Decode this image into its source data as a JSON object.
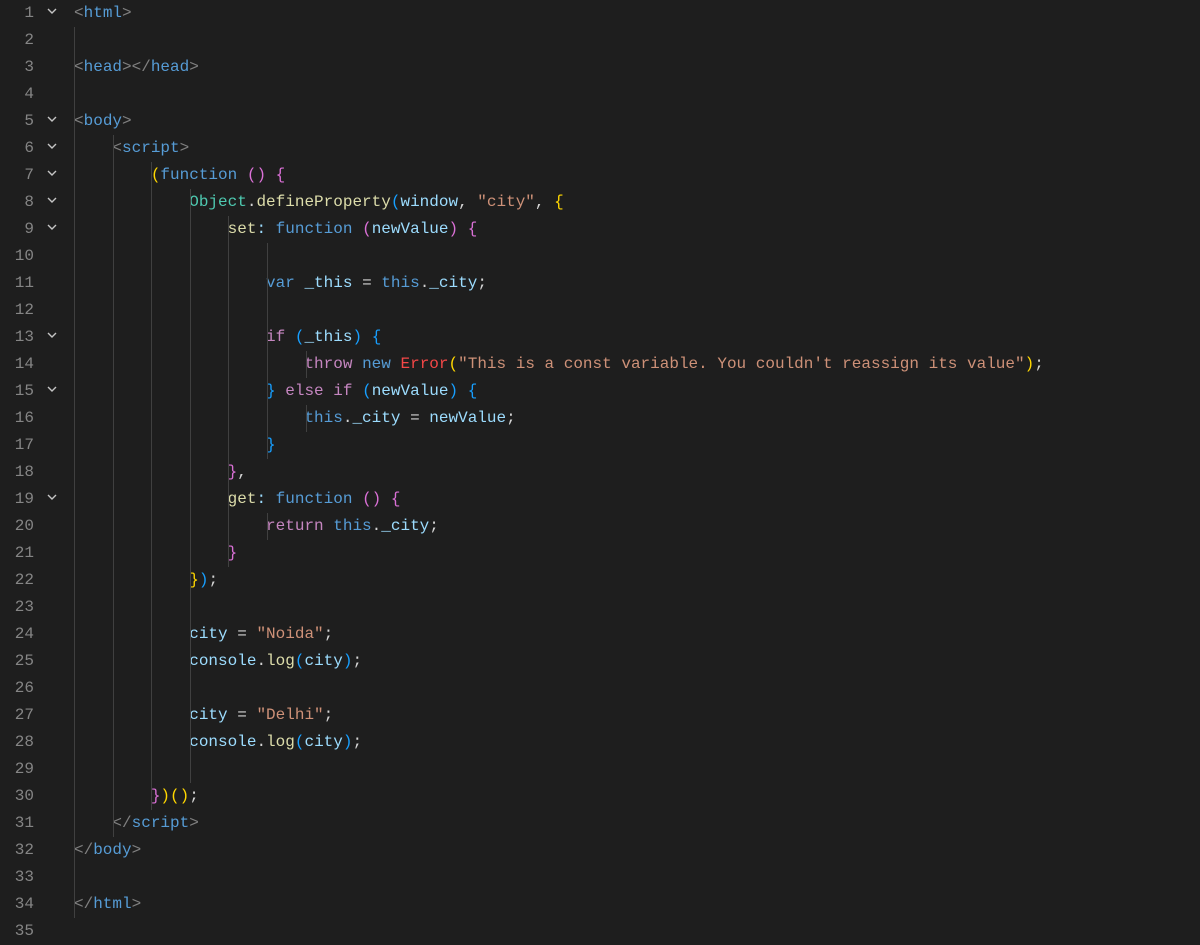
{
  "lines": [
    {
      "n": 1,
      "fold": "v",
      "guides": [],
      "tokens": [
        {
          "c": "punct",
          "t": "<"
        },
        {
          "c": "tag",
          "t": "html"
        },
        {
          "c": "punct",
          "t": ">"
        }
      ]
    },
    {
      "n": 2,
      "fold": "",
      "guides": [
        0
      ],
      "tokens": []
    },
    {
      "n": 3,
      "fold": "",
      "guides": [
        0
      ],
      "tokens": [
        {
          "c": "punct",
          "t": "<"
        },
        {
          "c": "tag",
          "t": "head"
        },
        {
          "c": "punct",
          "t": "></"
        },
        {
          "c": "tag",
          "t": "head"
        },
        {
          "c": "punct",
          "t": ">"
        }
      ]
    },
    {
      "n": 4,
      "fold": "",
      "guides": [
        0
      ],
      "tokens": []
    },
    {
      "n": 5,
      "fold": "v",
      "guides": [
        0
      ],
      "tokens": [
        {
          "c": "punct",
          "t": "<"
        },
        {
          "c": "tag",
          "t": "body"
        },
        {
          "c": "punct",
          "t": ">"
        }
      ]
    },
    {
      "n": 6,
      "fold": "v",
      "guides": [
        0,
        1
      ],
      "tokens": [
        {
          "c": "op",
          "t": "    "
        },
        {
          "c": "punct",
          "t": "<"
        },
        {
          "c": "tag",
          "t": "script"
        },
        {
          "c": "punct",
          "t": ">"
        }
      ]
    },
    {
      "n": 7,
      "fold": "v",
      "guides": [
        0,
        1,
        2
      ],
      "tokens": [
        {
          "c": "op",
          "t": "        "
        },
        {
          "c": "brace0",
          "t": "("
        },
        {
          "c": "kw",
          "t": "function"
        },
        {
          "c": "op",
          "t": " "
        },
        {
          "c": "brace1",
          "t": "()"
        },
        {
          "c": "op",
          "t": " "
        },
        {
          "c": "brace1",
          "t": "{"
        }
      ]
    },
    {
      "n": 8,
      "fold": "v",
      "guides": [
        0,
        1,
        2,
        3
      ],
      "tokens": [
        {
          "c": "op",
          "t": "            "
        },
        {
          "c": "cls",
          "t": "Object"
        },
        {
          "c": "op",
          "t": "."
        },
        {
          "c": "func",
          "t": "defineProperty"
        },
        {
          "c": "brace2",
          "t": "("
        },
        {
          "c": "ident",
          "t": "window"
        },
        {
          "c": "op",
          "t": ", "
        },
        {
          "c": "str",
          "t": "\"city\""
        },
        {
          "c": "op",
          "t": ", "
        },
        {
          "c": "brace3",
          "t": "{"
        }
      ]
    },
    {
      "n": 9,
      "fold": "v",
      "guides": [
        0,
        1,
        2,
        3,
        4
      ],
      "tokens": [
        {
          "c": "op",
          "t": "                "
        },
        {
          "c": "func",
          "t": "set"
        },
        {
          "c": "ident",
          "t": ":"
        },
        {
          "c": "op",
          "t": " "
        },
        {
          "c": "kw",
          "t": "function"
        },
        {
          "c": "op",
          "t": " "
        },
        {
          "c": "brace4",
          "t": "("
        },
        {
          "c": "ident",
          "t": "newValue"
        },
        {
          "c": "brace4",
          "t": ")"
        },
        {
          "c": "op",
          "t": " "
        },
        {
          "c": "brace4",
          "t": "{"
        }
      ]
    },
    {
      "n": 10,
      "fold": "",
      "guides": [
        0,
        1,
        2,
        3,
        4,
        5
      ],
      "tokens": []
    },
    {
      "n": 11,
      "fold": "",
      "guides": [
        0,
        1,
        2,
        3,
        4,
        5
      ],
      "tokens": [
        {
          "c": "op",
          "t": "                    "
        },
        {
          "c": "kw",
          "t": "var"
        },
        {
          "c": "op",
          "t": " "
        },
        {
          "c": "ident",
          "t": "_this"
        },
        {
          "c": "op",
          "t": " = "
        },
        {
          "c": "kw",
          "t": "this"
        },
        {
          "c": "op",
          "t": "."
        },
        {
          "c": "ident",
          "t": "_city"
        },
        {
          "c": "op",
          "t": ";"
        }
      ]
    },
    {
      "n": 12,
      "fold": "",
      "guides": [
        0,
        1,
        2,
        3,
        4,
        5
      ],
      "tokens": []
    },
    {
      "n": 13,
      "fold": "v",
      "guides": [
        0,
        1,
        2,
        3,
        4,
        5
      ],
      "tokens": [
        {
          "c": "op",
          "t": "                    "
        },
        {
          "c": "kw2",
          "t": "if"
        },
        {
          "c": "op",
          "t": " "
        },
        {
          "c": "brace5",
          "t": "("
        },
        {
          "c": "ident",
          "t": "_this"
        },
        {
          "c": "brace5",
          "t": ")"
        },
        {
          "c": "op",
          "t": " "
        },
        {
          "c": "brace5",
          "t": "{"
        }
      ]
    },
    {
      "n": 14,
      "fold": "",
      "guides": [
        0,
        1,
        2,
        3,
        4,
        5,
        6
      ],
      "tokens": [
        {
          "c": "op",
          "t": "                        "
        },
        {
          "c": "kw2",
          "t": "throw"
        },
        {
          "c": "op",
          "t": " "
        },
        {
          "c": "kw",
          "t": "new"
        },
        {
          "c": "op",
          "t": " "
        },
        {
          "c": "err",
          "t": "Error"
        },
        {
          "c": "brace0",
          "t": "("
        },
        {
          "c": "str",
          "t": "\"This is a const variable. You couldn't reassign its value\""
        },
        {
          "c": "brace0",
          "t": ")"
        },
        {
          "c": "op",
          "t": ";"
        }
      ]
    },
    {
      "n": 15,
      "fold": "v",
      "guides": [
        0,
        1,
        2,
        3,
        4,
        5
      ],
      "tokens": [
        {
          "c": "op",
          "t": "                    "
        },
        {
          "c": "brace5",
          "t": "}"
        },
        {
          "c": "op",
          "t": " "
        },
        {
          "c": "kw2",
          "t": "else"
        },
        {
          "c": "op",
          "t": " "
        },
        {
          "c": "kw2",
          "t": "if"
        },
        {
          "c": "op",
          "t": " "
        },
        {
          "c": "brace5",
          "t": "("
        },
        {
          "c": "ident",
          "t": "newValue"
        },
        {
          "c": "brace5",
          "t": ")"
        },
        {
          "c": "op",
          "t": " "
        },
        {
          "c": "brace5",
          "t": "{"
        }
      ]
    },
    {
      "n": 16,
      "fold": "",
      "guides": [
        0,
        1,
        2,
        3,
        4,
        5,
        6
      ],
      "tokens": [
        {
          "c": "op",
          "t": "                        "
        },
        {
          "c": "kw",
          "t": "this"
        },
        {
          "c": "op",
          "t": "."
        },
        {
          "c": "ident",
          "t": "_city"
        },
        {
          "c": "op",
          "t": " = "
        },
        {
          "c": "ident",
          "t": "newValue"
        },
        {
          "c": "op",
          "t": ";"
        }
      ]
    },
    {
      "n": 17,
      "fold": "",
      "guides": [
        0,
        1,
        2,
        3,
        4,
        5
      ],
      "tokens": [
        {
          "c": "op",
          "t": "                    "
        },
        {
          "c": "brace5",
          "t": "}"
        }
      ]
    },
    {
      "n": 18,
      "fold": "",
      "guides": [
        0,
        1,
        2,
        3,
        4
      ],
      "tokens": [
        {
          "c": "op",
          "t": "                "
        },
        {
          "c": "brace4",
          "t": "}"
        },
        {
          "c": "op",
          "t": ","
        }
      ]
    },
    {
      "n": 19,
      "fold": "v",
      "guides": [
        0,
        1,
        2,
        3,
        4
      ],
      "tokens": [
        {
          "c": "op",
          "t": "                "
        },
        {
          "c": "func",
          "t": "get"
        },
        {
          "c": "ident",
          "t": ":"
        },
        {
          "c": "op",
          "t": " "
        },
        {
          "c": "kw",
          "t": "function"
        },
        {
          "c": "op",
          "t": " "
        },
        {
          "c": "brace4",
          "t": "()"
        },
        {
          "c": "op",
          "t": " "
        },
        {
          "c": "brace4",
          "t": "{"
        }
      ]
    },
    {
      "n": 20,
      "fold": "",
      "guides": [
        0,
        1,
        2,
        3,
        4,
        5
      ],
      "tokens": [
        {
          "c": "op",
          "t": "                    "
        },
        {
          "c": "kw2",
          "t": "return"
        },
        {
          "c": "op",
          "t": " "
        },
        {
          "c": "kw",
          "t": "this"
        },
        {
          "c": "op",
          "t": "."
        },
        {
          "c": "ident",
          "t": "_city"
        },
        {
          "c": "op",
          "t": ";"
        }
      ]
    },
    {
      "n": 21,
      "fold": "",
      "guides": [
        0,
        1,
        2,
        3,
        4
      ],
      "tokens": [
        {
          "c": "op",
          "t": "                "
        },
        {
          "c": "brace4",
          "t": "}"
        }
      ]
    },
    {
      "n": 22,
      "fold": "",
      "guides": [
        0,
        1,
        2,
        3
      ],
      "tokens": [
        {
          "c": "op",
          "t": "            "
        },
        {
          "c": "brace3",
          "t": "}"
        },
        {
          "c": "brace2",
          "t": ")"
        },
        {
          "c": "op",
          "t": ";"
        }
      ]
    },
    {
      "n": 23,
      "fold": "",
      "guides": [
        0,
        1,
        2,
        3
      ],
      "tokens": []
    },
    {
      "n": 24,
      "fold": "",
      "guides": [
        0,
        1,
        2,
        3
      ],
      "tokens": [
        {
          "c": "op",
          "t": "            "
        },
        {
          "c": "ident",
          "t": "city"
        },
        {
          "c": "op",
          "t": " = "
        },
        {
          "c": "str",
          "t": "\"Noida\""
        },
        {
          "c": "op",
          "t": ";"
        }
      ]
    },
    {
      "n": 25,
      "fold": "",
      "guides": [
        0,
        1,
        2,
        3
      ],
      "tokens": [
        {
          "c": "op",
          "t": "            "
        },
        {
          "c": "ident",
          "t": "console"
        },
        {
          "c": "op",
          "t": "."
        },
        {
          "c": "func",
          "t": "log"
        },
        {
          "c": "brace2",
          "t": "("
        },
        {
          "c": "ident",
          "t": "city"
        },
        {
          "c": "brace2",
          "t": ")"
        },
        {
          "c": "op",
          "t": ";"
        }
      ]
    },
    {
      "n": 26,
      "fold": "",
      "guides": [
        0,
        1,
        2,
        3
      ],
      "tokens": []
    },
    {
      "n": 27,
      "fold": "",
      "guides": [
        0,
        1,
        2,
        3
      ],
      "tokens": [
        {
          "c": "op",
          "t": "            "
        },
        {
          "c": "ident",
          "t": "city"
        },
        {
          "c": "op",
          "t": " = "
        },
        {
          "c": "str",
          "t": "\"Delhi\""
        },
        {
          "c": "op",
          "t": ";"
        }
      ]
    },
    {
      "n": 28,
      "fold": "",
      "guides": [
        0,
        1,
        2,
        3
      ],
      "tokens": [
        {
          "c": "op",
          "t": "            "
        },
        {
          "c": "ident",
          "t": "console"
        },
        {
          "c": "op",
          "t": "."
        },
        {
          "c": "func",
          "t": "log"
        },
        {
          "c": "brace2",
          "t": "("
        },
        {
          "c": "ident",
          "t": "city"
        },
        {
          "c": "brace2",
          "t": ")"
        },
        {
          "c": "op",
          "t": ";"
        }
      ]
    },
    {
      "n": 29,
      "fold": "",
      "guides": [
        0,
        1,
        2,
        3
      ],
      "tokens": []
    },
    {
      "n": 30,
      "fold": "",
      "guides": [
        0,
        1,
        2
      ],
      "tokens": [
        {
          "c": "op",
          "t": "        "
        },
        {
          "c": "brace1",
          "t": "}"
        },
        {
          "c": "brace0",
          "t": ")"
        },
        {
          "c": "brace0",
          "t": "()"
        },
        {
          "c": "op",
          "t": ";"
        }
      ]
    },
    {
      "n": 31,
      "fold": "",
      "guides": [
        0,
        1
      ],
      "tokens": [
        {
          "c": "op",
          "t": "    "
        },
        {
          "c": "punct",
          "t": "</"
        },
        {
          "c": "tag",
          "t": "script"
        },
        {
          "c": "punct",
          "t": ">"
        }
      ]
    },
    {
      "n": 32,
      "fold": "",
      "guides": [
        0
      ],
      "tokens": [
        {
          "c": "punct",
          "t": "</"
        },
        {
          "c": "tag",
          "t": "body"
        },
        {
          "c": "punct",
          "t": ">"
        }
      ]
    },
    {
      "n": 33,
      "fold": "",
      "guides": [
        0
      ],
      "tokens": []
    },
    {
      "n": 34,
      "fold": "",
      "guides": [
        0
      ],
      "tokens": [
        {
          "c": "punct",
          "t": "</"
        },
        {
          "c": "tag",
          "t": "html"
        },
        {
          "c": "punct",
          "t": ">"
        }
      ]
    },
    {
      "n": 35,
      "fold": "",
      "guides": [],
      "tokens": []
    }
  ],
  "indentWidthPx": 38.6,
  "codeLeftPad": 10
}
